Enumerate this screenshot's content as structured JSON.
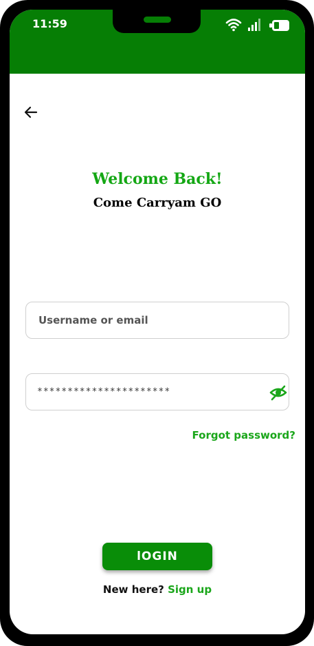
{
  "status_bar": {
    "time": "11:59",
    "icons": [
      "wifi-icon",
      "signal-icon",
      "battery-icon"
    ]
  },
  "colors": {
    "primary": "#067e05",
    "accent": "#1aa61a",
    "button": "#098d08"
  },
  "header": {
    "back_icon": "arrow-left-icon",
    "welcome": "Welcome Back!",
    "subtitle": "Come Carryam GO"
  },
  "form": {
    "username_placeholder": "Username or email",
    "password_value": "**********************",
    "password_toggle_icon": "eye-off-icon",
    "forgot_label": "Forgot password?"
  },
  "actions": {
    "login_label": "lOGIN",
    "signup_prompt": "New here?",
    "signup_label": "Sign up"
  }
}
